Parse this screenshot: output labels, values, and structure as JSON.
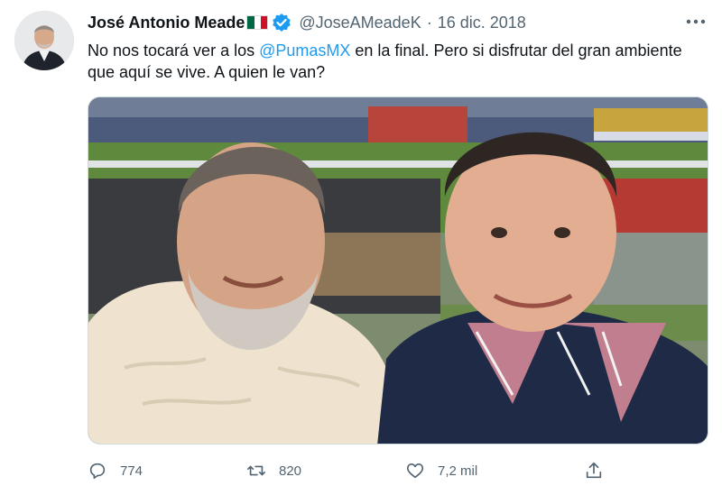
{
  "tweet": {
    "author_name": "José Antonio Meade",
    "handle": "@JoseAMeadeK",
    "separator": "·",
    "date": "16 dic. 2018",
    "text_part1": "No nos tocará ver a los ",
    "mention": "@PumasMX",
    "text_part2": " en la final. Pero si disfrutar del gran ambiente que aquí se vive. A quien le van?",
    "replies": "774",
    "retweets": "820",
    "likes": "7,2 mil"
  },
  "colors": {
    "accent": "#1d9bf0",
    "secondary_text": "#536471",
    "flag_green": "#006847",
    "flag_white": "#ffffff",
    "flag_red": "#ce1126"
  },
  "icons": {
    "verified": "verified-badge-icon",
    "more": "more-dots-icon",
    "reply": "reply-icon",
    "retweet": "retweet-icon",
    "like": "heart-icon",
    "share": "share-icon"
  }
}
